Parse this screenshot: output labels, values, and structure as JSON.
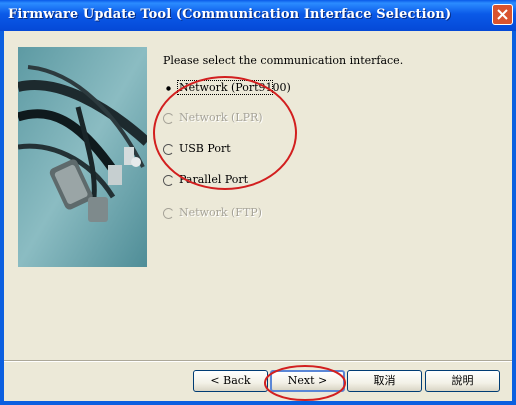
{
  "window": {
    "title": "Firmware Update Tool (Communication Interface Selection)"
  },
  "icons": {
    "close": "close-icon",
    "picture": "cables-photo"
  },
  "prompt": "Please select the communication interface.",
  "options": [
    {
      "label": "Network (Port9100)",
      "enabled": true,
      "selected": true
    },
    {
      "label": "Network (LPR)",
      "enabled": false,
      "selected": false
    },
    {
      "label": "USB Port",
      "enabled": true,
      "selected": false
    },
    {
      "label": "Parallel Port",
      "enabled": true,
      "selected": false
    },
    {
      "label": "Network (FTP)",
      "enabled": false,
      "selected": false
    }
  ],
  "buttons": {
    "back": "< Back",
    "next": "Next >",
    "cancel": "取消",
    "help": "說明"
  },
  "colors": {
    "titlebar": "#0a5ae8",
    "annotation": "#d21f1f",
    "disabled_text": "#a6a398"
  }
}
